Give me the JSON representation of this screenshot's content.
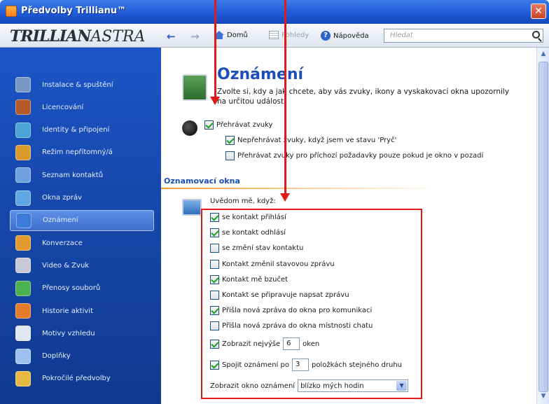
{
  "window": {
    "title": "Předvolby Trillianu™",
    "close_glyph": "✕"
  },
  "toolbar": {
    "logo_bold": "TRILLIAN",
    "logo_light": "ASTRA",
    "back_glyph": "←",
    "forward_glyph": "→",
    "home_label": "Domů",
    "views_label": "Pohledy",
    "help_label": "Nápověda",
    "help_glyph": "?",
    "search_placeholder": "Hledat"
  },
  "sidebar": {
    "items": [
      {
        "label": "Instalace & spuštění",
        "icon": "install-icon",
        "color": "#7a98c4"
      },
      {
        "label": "Licencování",
        "icon": "license-icon",
        "color": "#b45a2a"
      },
      {
        "label": "Identity & připojení",
        "icon": "identity-icon",
        "color": "#4aa3d6"
      },
      {
        "label": "Režim nepřítomný/á",
        "icon": "away-icon",
        "color": "#d89a2a"
      },
      {
        "label": "Seznam kontaktů",
        "icon": "contacts-icon",
        "color": "#6fa0e0"
      },
      {
        "label": "Okna zpráv",
        "icon": "message-windows-icon",
        "color": "#5fa6e4"
      },
      {
        "label": "Oznámení",
        "icon": "notifications-icon",
        "color": "#3c7bd8",
        "active": true
      },
      {
        "label": "Konverzace",
        "icon": "conversation-icon",
        "color": "#e39a2f"
      },
      {
        "label": "Video & Zvuk",
        "icon": "video-sound-icon",
        "color": "#c8c8d8"
      },
      {
        "label": "Přenosy souborů",
        "icon": "file-transfer-icon",
        "color": "#4caf50"
      },
      {
        "label": "Historie aktivit",
        "icon": "history-icon",
        "color": "#e57b2a"
      },
      {
        "label": "Motivy vzhledu",
        "icon": "themes-icon",
        "color": "#dfe7f5"
      },
      {
        "label": "Doplňky",
        "icon": "plugins-icon",
        "color": "#9cc0f0"
      },
      {
        "label": "Pokročilé předvolby",
        "icon": "advanced-icon",
        "color": "#e7b940"
      }
    ]
  },
  "main": {
    "title": "Oznámení",
    "description": "Zvolte si, kdy a jak chcete, aby vás zvuky, ikony a vyskakovací okna upozornily na určitou událost.",
    "sound": {
      "play_sounds": {
        "label": "Přehrávat zvuky",
        "checked": true
      },
      "not_when_away": {
        "label": "Nepřehrávat zvuky, když jsem ve stavu 'Pryč'",
        "checked": true
      },
      "background_only": {
        "label": "Přehrávat zvuky pro příchozí požadavky pouze pokud je okno v pozadí",
        "checked": false
      }
    },
    "section_title": "Oznamovací okna",
    "notify_label": "Uvědom mě, když:",
    "options": [
      {
        "label": "se kontakt přihlásí",
        "checked": true
      },
      {
        "label": "se kontakt odhlásí",
        "checked": true
      },
      {
        "label": "se změní stav kontaktu",
        "checked": false
      },
      {
        "label": "Kontakt změnil stavovou zprávu",
        "checked": false
      },
      {
        "label": "Kontakt mě bzučet",
        "checked": true
      },
      {
        "label": "Kontakt se připravuje napsat zprávu",
        "checked": false
      },
      {
        "label": "Přišla nová zpráva do okna pro komunikaci",
        "checked": true
      },
      {
        "label": "Přišla nová zpráva do okna místnosti chatu",
        "checked": false
      }
    ],
    "max_show": {
      "prefix": "Zobrazit nejvýše",
      "value": "6",
      "suffix": "oken",
      "checked": true
    },
    "merge": {
      "prefix": "Spojit oznámení po",
      "value": "3",
      "suffix": "položkách stejného druhu",
      "checked": true
    },
    "position": {
      "label": "Zobrazit okno oznámení",
      "value": "blízko mých hodin"
    }
  },
  "colors": {
    "accent": "#1b4fb7",
    "annotation": "#e11919",
    "section_rule": "#f59a2d"
  }
}
